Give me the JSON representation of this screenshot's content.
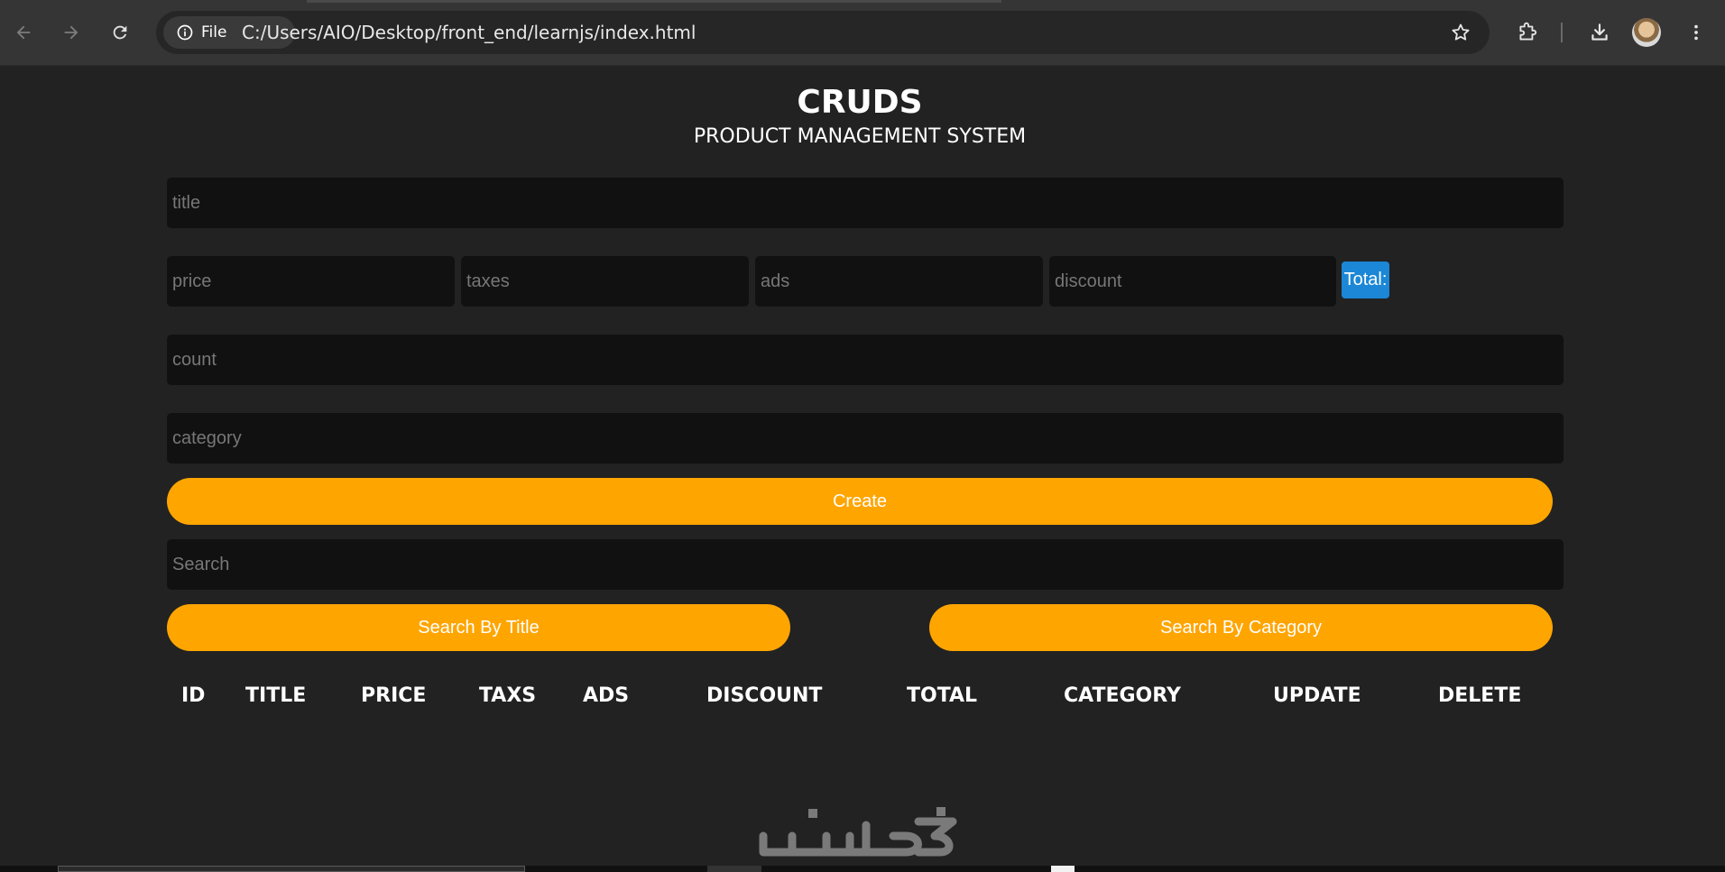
{
  "browser": {
    "site_chip_label": "File",
    "url": "C:/Users/AIO/Desktop/front_end/learnjs/index.html",
    "icons": [
      "back-arrow-icon",
      "forward-arrow-icon",
      "reload-icon",
      "info-icon",
      "star-icon",
      "extensions-puzzle-icon",
      "download-icon",
      "avatar",
      "more-vert-icon"
    ]
  },
  "app": {
    "title": "CRUDS",
    "subtitle": "PRODUCT MANAGEMENT SYSTEM"
  },
  "form": {
    "title_placeholder": "title",
    "price_placeholder": "price",
    "taxes_placeholder": "taxes",
    "ads_placeholder": "ads",
    "discount_placeholder": "discount",
    "total_label": "Total:",
    "count_placeholder": "count",
    "category_placeholder": "category",
    "create_label": "Create"
  },
  "search": {
    "placeholder": "Search",
    "by_title_label": "Search By Title",
    "by_category_label": "Search By Category"
  },
  "table": {
    "headers": [
      "ID",
      "TITLE",
      "PRICE",
      "TAXS",
      "ADS",
      "DISCOUNT",
      "TOTAL",
      "CATEGORY",
      "UPDATE",
      "DELETE"
    ],
    "rows": []
  },
  "colors": {
    "accent": "#ffa500",
    "total_badge": "#1b87d6",
    "background": "#222222",
    "input_bg": "#111111"
  }
}
